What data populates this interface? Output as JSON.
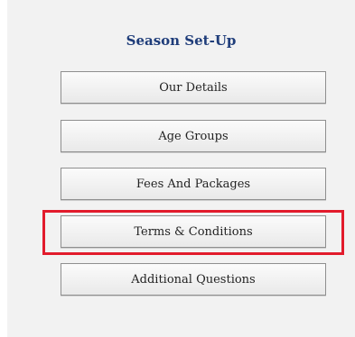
{
  "section": {
    "title": "Season Set-Up"
  },
  "menu": {
    "items": [
      {
        "label": "Our Details"
      },
      {
        "label": "Age Groups"
      },
      {
        "label": "Fees And Packages"
      },
      {
        "label": "Terms & Conditions"
      },
      {
        "label": "Additional Questions"
      }
    ]
  },
  "colors": {
    "title": "#1f3d7a",
    "panel_background": "#f2f2f2",
    "highlight": "#e21b2c"
  }
}
